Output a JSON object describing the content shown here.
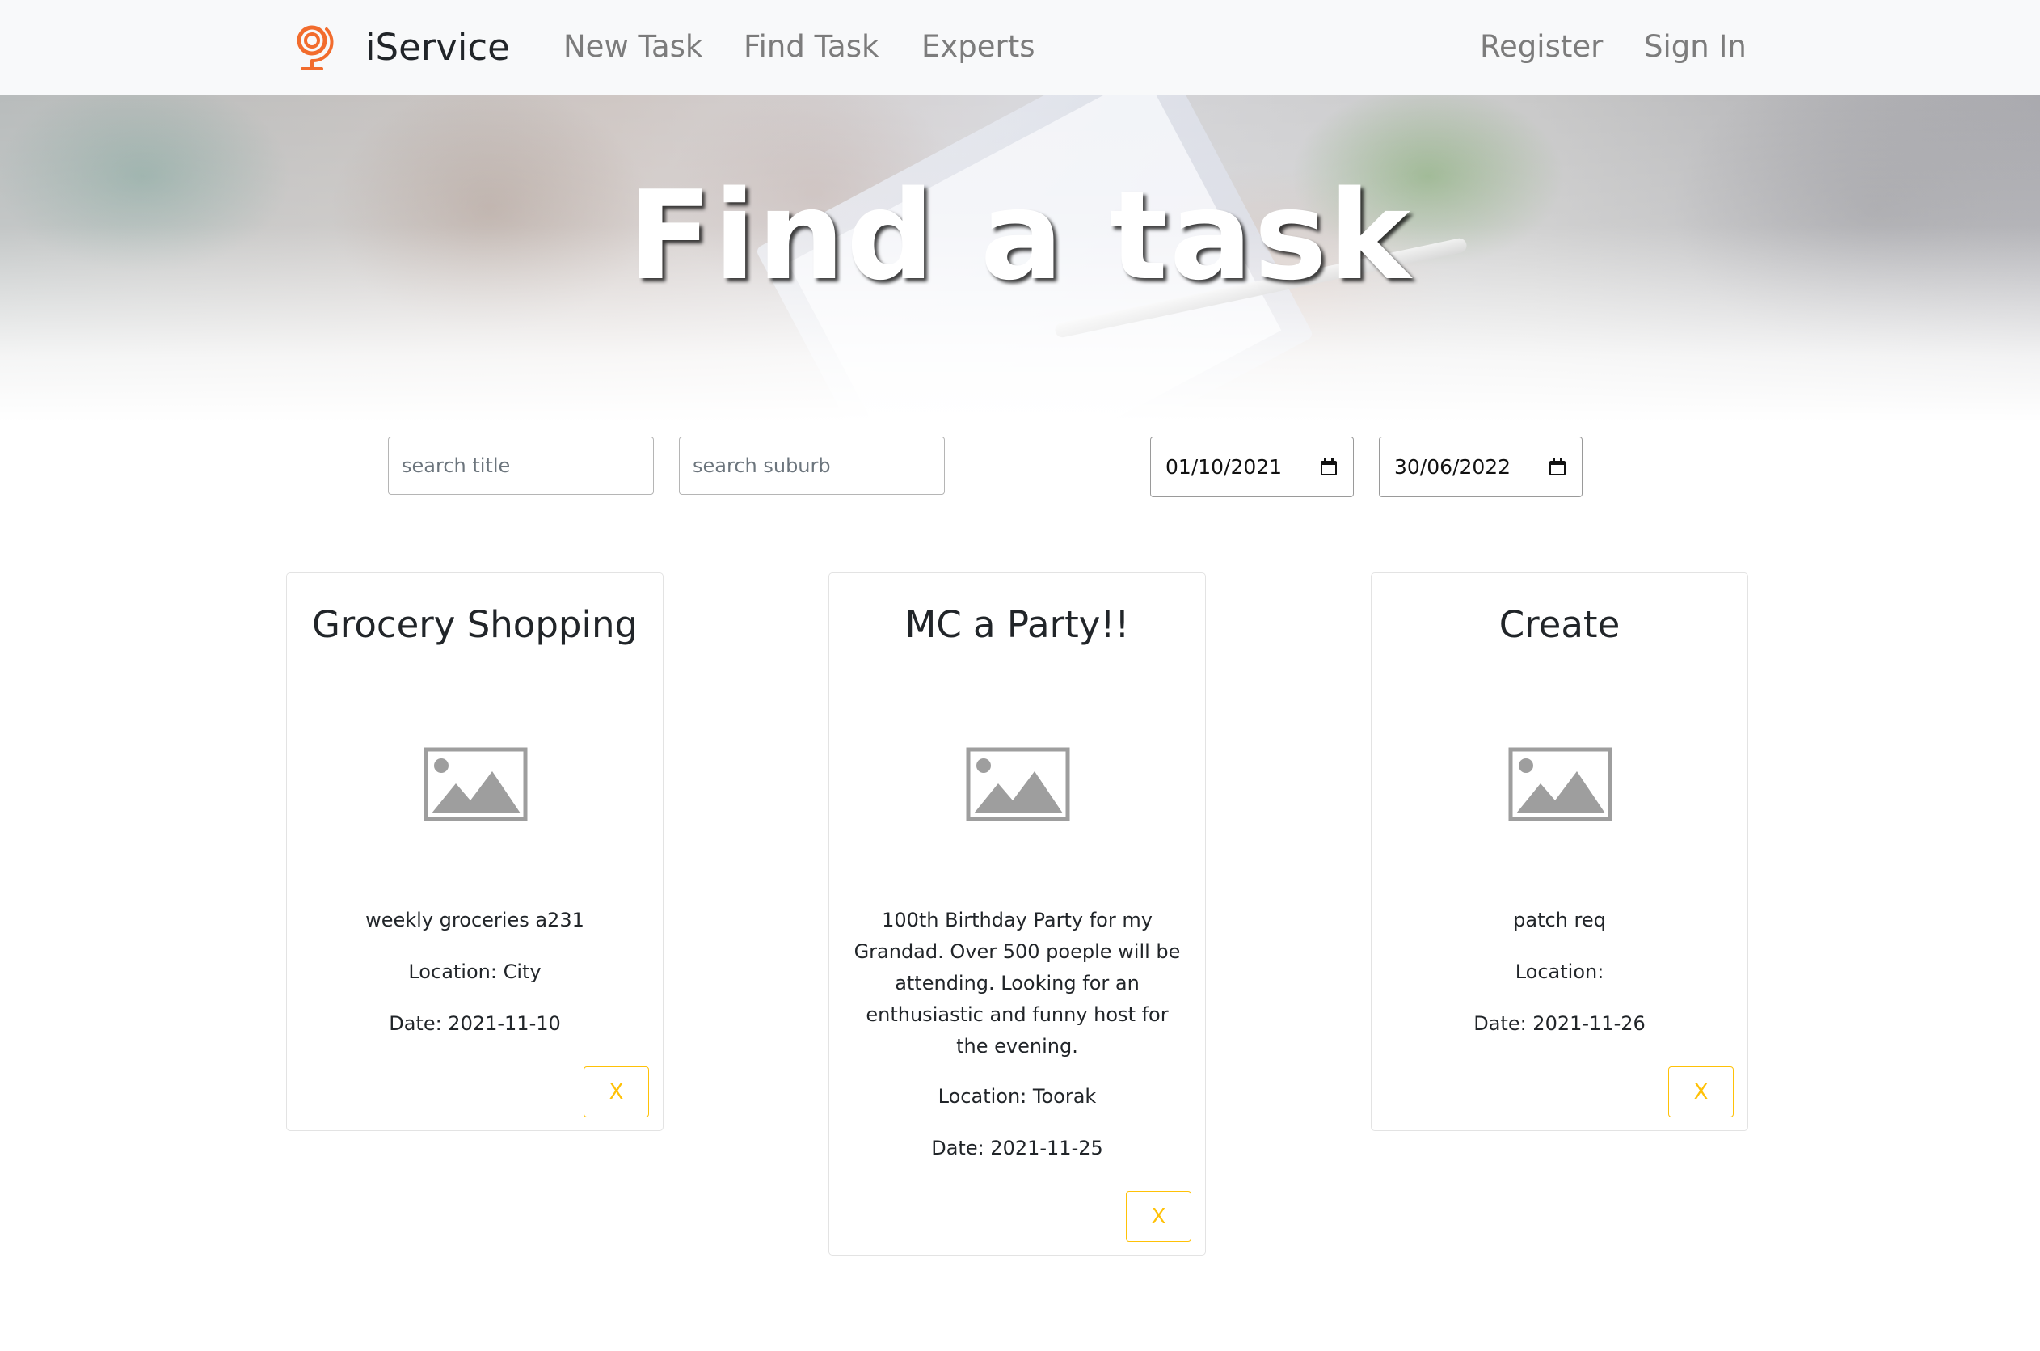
{
  "navbar": {
    "brand": "iService",
    "brand_icon": "globe-stand-icon",
    "links": [
      "New Task",
      "Find Task",
      "Experts"
    ],
    "auth": [
      "Register",
      "Sign In"
    ]
  },
  "hero": {
    "title": "Find a task"
  },
  "search": {
    "title_placeholder": "search title",
    "suburb_placeholder": "search suburb",
    "start_date": "01/10/2021",
    "end_date": "30/06/2022",
    "calendar_icon": "calendar-icon"
  },
  "tasks": [
    {
      "title": "Grocery Shopping",
      "description": "weekly groceries a231",
      "location": "Location: City",
      "date": "Date: 2021-11-10",
      "button": "X"
    },
    {
      "title": "MC a Party!!",
      "description": "100th Birthday Party for my Grandad. Over 500 poeple will be attending. Looking for an enthusiastic and funny host for the evening.",
      "location": "Location: Toorak",
      "date": "Date: 2021-11-25",
      "button": "X"
    },
    {
      "title": "Create",
      "description": "patch req",
      "location": "Location:",
      "date": "Date: 2021-11-26",
      "button": "X"
    }
  ],
  "colors": {
    "brand_accent": "#f26c2d",
    "nav_background": "#f8f9fa",
    "nav_link": "#7c7c7c",
    "warning": "#ffc107"
  }
}
